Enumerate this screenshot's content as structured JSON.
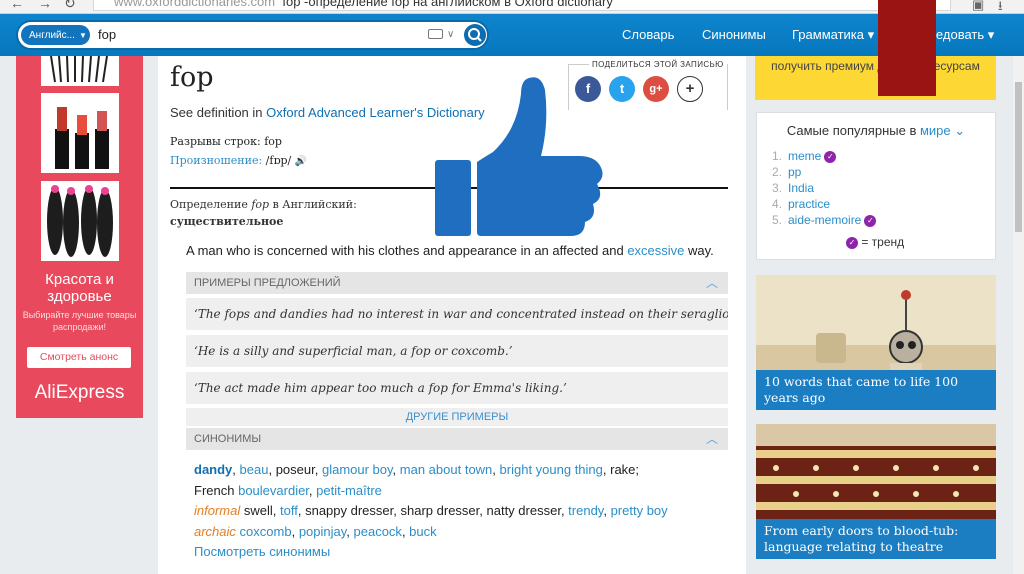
{
  "browser": {
    "back": "←",
    "forward": "→",
    "reload": "↻",
    "url_host": "www.oxforddictionaries.com",
    "url_title": "fop -определение fop на английском в Oxford dictionary"
  },
  "header": {
    "lang_label": "Английс...",
    "query": "fop",
    "menu_dictionary": "Словарь",
    "menu_synonyms": "Синонимы",
    "menu_grammar": "Грамматика",
    "menu_explore": "Исследовать"
  },
  "entry": {
    "headword": "fop",
    "see_definition_prefix": "See definition in ",
    "see_definition_link": "Oxford Advanced Learner's Dictionary",
    "share_label": "ПОДЕЛИТЬСЯ ЭТОЙ ЗАПИСЬЮ",
    "line_breaks_label": "Разрывы строк:",
    "line_breaks_value": "fop",
    "pronunciation_label": "Произношение:",
    "pronunciation_value": "/fɒp/",
    "definition_heading_pre": "Определение ",
    "definition_heading_word": "fop",
    "definition_heading_post": " в Английский:",
    "part_of_speech": "существительное",
    "definition_text": "A man who is concerned with his clothes and appearance in an affected and ",
    "definition_link": "excessive",
    "definition_end": " way.",
    "examples_heading": "ПРИМЕРЫ ПРЕДЛОЖЕНИЙ",
    "examples": [
      "‘The fops and dandies had no interest in war and concentrated instead on their seraglios.’",
      "‘He is a silly and superficial man, a fop or coxcomb.’",
      "‘The act made him appear too much a fop for Emma's liking.’"
    ],
    "more_examples": "ДРУГИЕ ПРИМЕРЫ",
    "synonyms_heading": "СИНОНИМЫ",
    "syn": {
      "dandy": "dandy",
      "beau": "beau",
      "poseur": "poseur",
      "glamour_boy": "glamour boy",
      "man_about_town": "man about town",
      "bright_young_thing": "bright young thing",
      "rake": "rake",
      "french": "French",
      "boulevardier": "boulevardier",
      "petit_maitre": "petit-maître",
      "informal": "informal",
      "swell": "swell",
      "toff": "toff",
      "snappy_dresser": "snappy dresser",
      "sharp_dresser": "sharp dresser",
      "natty_dresser": "natty dresser",
      "trendy": "trendy",
      "pretty_boy": "pretty boy",
      "archaic": "archaic",
      "coxcomb": "coxcomb",
      "popinjay": "popinjay",
      "peacock": "peacock",
      "buck": "buck",
      "view_synonyms": "Посмотреть синонимы"
    }
  },
  "ad": {
    "title": "Красота и здоровье",
    "subtitle": "Выбирайте лучшие товары распродажи!",
    "button": "Смотреть анонс",
    "brand": "AliExpress",
    "brand_color": "#e8495c"
  },
  "sidebar": {
    "banner_text": "получить премиум доступ к ресурсам",
    "popular_heading_pre": "Самые популярные в ",
    "popular_heading_link": "мире",
    "popular": [
      {
        "n": "1.",
        "word": "meme",
        "trend": true
      },
      {
        "n": "2.",
        "word": "pp",
        "trend": false
      },
      {
        "n": "3.",
        "word": "India",
        "trend": false
      },
      {
        "n": "4.",
        "word": "practice",
        "trend": false
      },
      {
        "n": "5.",
        "word": "aide-memoire",
        "trend": true
      }
    ],
    "trend_legend": "= тренд",
    "card1_caption": "10 words that came to life 100 years ago",
    "card2_caption": "From early doors to blood-tub: language relating to theatre"
  },
  "colors": {
    "brand_blue": "#0d85ce",
    "link": "#2a8ec9",
    "thumb": "#1f6ec0",
    "trend": "#8e24aa",
    "banner": "#fdd835",
    "caption": "#1b7ec2"
  }
}
